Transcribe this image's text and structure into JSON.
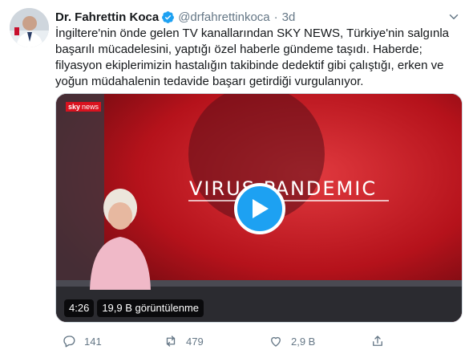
{
  "tweet": {
    "author_name": "Dr. Fahrettin Koca",
    "handle": "@drfahrettinkoca",
    "separator": "·",
    "time": "3d",
    "lines": [
      "İngiltere'nin önde gelen TV kanallarından SKY NEWS, Türkiye'nin salgınla",
      "başarılı mücadelesini, yaptığı özel haberle gündeme taşıdı. Haberde;",
      "filyasyon ekiplerimizin hastalığın takibinde dedektif gibi çalıştığı, erken ve",
      "yoğun müdahalenin tedavide başarı getirdiği vurgulanıyor."
    ]
  },
  "media": {
    "channel_logo_bold": "sky",
    "channel_logo_text": "news",
    "banner_text": "VIRUS PANDEMIC",
    "duration": "4:26",
    "views": "19,9 B görüntülenme",
    "progress": 0
  },
  "actions": {
    "reply_count": "141",
    "retweet_count": "479",
    "like_count": "2,9 B"
  },
  "colors": {
    "accent": "#1da1f2",
    "studio_red": "#b5121b",
    "muted_text": "#657786"
  },
  "icons": [
    "verified-badge-icon",
    "chevron-down-icon",
    "play-icon",
    "reply-icon",
    "retweet-icon",
    "like-icon",
    "share-icon"
  ]
}
